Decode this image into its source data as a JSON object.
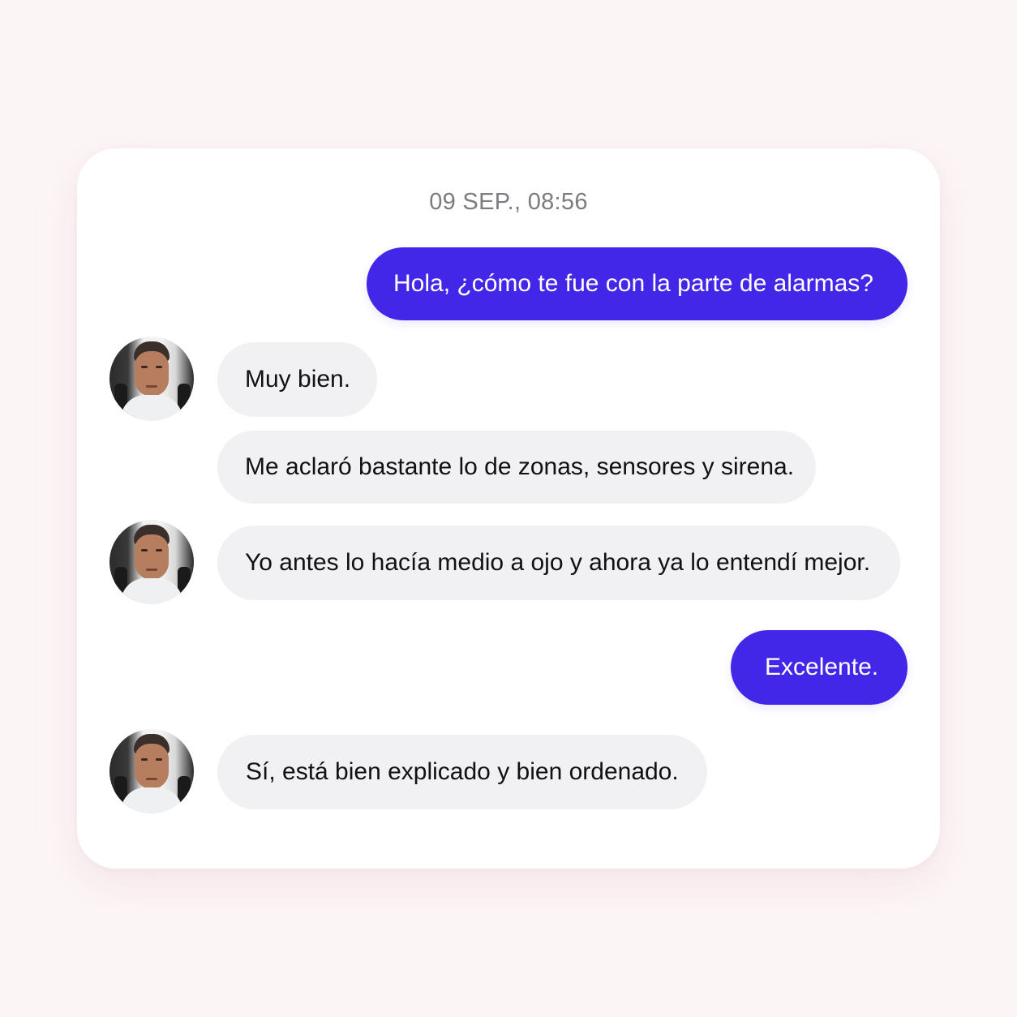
{
  "conversation": {
    "timestamp": "09 SEP., 08:56",
    "messages": [
      {
        "sender": "me",
        "text": "Hola, ¿cómo te fue con la parte de alarmas?"
      },
      {
        "sender": "contact",
        "text": "Muy bien."
      },
      {
        "sender": "contact",
        "text": "Me aclaró bastante lo de zonas, sensores y sirena."
      },
      {
        "sender": "contact",
        "text": "Yo antes lo hacía medio a ojo y ahora ya lo entendí mejor."
      },
      {
        "sender": "me",
        "text": "Excelente."
      },
      {
        "sender": "contact",
        "text": "Sí, está bien explicado y bien ordenado."
      }
    ]
  },
  "colors": {
    "page_background": "#fcf5f6",
    "card_background": "#ffffff",
    "outgoing_bubble": "#4327e8",
    "incoming_bubble": "#f1f1f3",
    "timestamp_text": "#7b7b80"
  },
  "icons": {
    "contact_avatar": "contact-avatar-photo"
  }
}
